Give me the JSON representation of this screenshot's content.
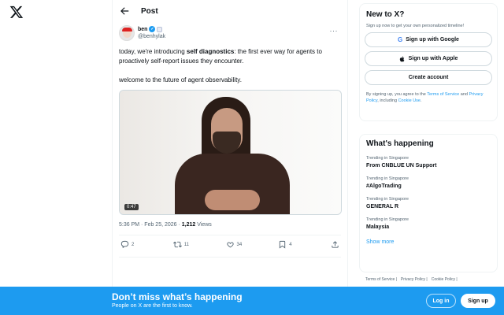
{
  "header": {
    "title": "Post"
  },
  "post": {
    "author_name": "ben",
    "author_handle": "@benhylak",
    "text_intro": "today, we're introducing ",
    "text_bold": "self diagnostics",
    "text_rest": ": the first ever way for agents to proactively self-report issues they encounter.",
    "text_line2": "welcome to the future of agent observability.",
    "video_duration": "0:47",
    "timestamp": "5:36 PM · Feb 25, 2026 · ",
    "views_count": "1,212",
    "views_label": " Views",
    "replies": "2",
    "reposts": "11",
    "likes": "34",
    "bookmarks": "4"
  },
  "signup_card": {
    "title": "New to X?",
    "subtitle": "Sign up now to get your own personalized timeline!",
    "google_label": "Sign up with Google",
    "apple_label": "Sign up with Apple",
    "create_label": "Create account",
    "legal_1": "By signing up, you agree to the ",
    "tos": "Terms of Service",
    "legal_2": " and ",
    "privacy": "Privacy Policy",
    "legal_3": ", including ",
    "cookie": "Cookie Use",
    "legal_4": "."
  },
  "happening": {
    "title": "What's happening",
    "trends": [
      {
        "meta": "Trending in Singapore",
        "name": "From CNBLUE UN Support"
      },
      {
        "meta": "Trending in Singapore",
        "name": "#AlgoTrading"
      },
      {
        "meta": "Trending in Singapore",
        "name": "GENERAL R"
      },
      {
        "meta": "Trending in Singapore",
        "name": "Malaysia"
      }
    ],
    "show_more": "Show more"
  },
  "footer": {
    "links": [
      "Terms of Service |",
      "Privacy Policy |",
      "Cookie Policy |"
    ]
  },
  "banner": {
    "title": "Don’t miss what’s happening",
    "subtitle": "People on X are the first to know.",
    "login": "Log in",
    "signup": "Sign up"
  },
  "colors": {
    "accent": "#1d9bf0",
    "text": "#0f1419",
    "muted": "#536471"
  }
}
